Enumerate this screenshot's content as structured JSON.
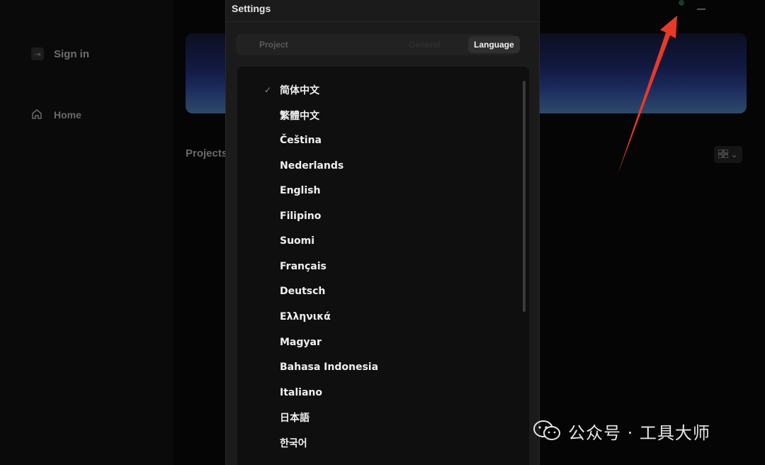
{
  "sidebar": {
    "sign_in_label": "Sign in",
    "home_label": "Home"
  },
  "main": {
    "projects_title": "Projects"
  },
  "settings": {
    "title": "Settings",
    "tabs": [
      {
        "label": "Project",
        "active": false
      },
      {
        "label": "General",
        "active": false
      },
      {
        "label": "Language",
        "active": true
      }
    ],
    "languages": [
      {
        "name": "简体中文",
        "selected": true
      },
      {
        "name": "繁體中文",
        "selected": false
      },
      {
        "name": "Čeština",
        "selected": false
      },
      {
        "name": "Nederlands",
        "selected": false
      },
      {
        "name": "English",
        "selected": false
      },
      {
        "name": "Filipino",
        "selected": false
      },
      {
        "name": "Suomi",
        "selected": false
      },
      {
        "name": "Français",
        "selected": false
      },
      {
        "name": "Deutsch",
        "selected": false
      },
      {
        "name": "Ελληνικά",
        "selected": false
      },
      {
        "name": "Magyar",
        "selected": false
      },
      {
        "name": "Bahasa Indonesia",
        "selected": false
      },
      {
        "name": "Italiano",
        "selected": false
      },
      {
        "name": "日本語",
        "selected": false
      },
      {
        "name": "한국어",
        "selected": false
      }
    ],
    "check_glyph": "✓"
  },
  "watermark": {
    "text": "公众号 · 工具大师"
  },
  "colors": {
    "arrow": "#e53a2a",
    "modal_bg": "#1b1b1b",
    "list_bg": "#0f0f0f",
    "active_tab_bg": "#2f2f2f"
  },
  "icons": {
    "sign_in": "user-login-icon",
    "home": "home-icon",
    "view_toggle": "grid-view-icon",
    "check": "check-icon",
    "watermark": "wechat-icon"
  }
}
